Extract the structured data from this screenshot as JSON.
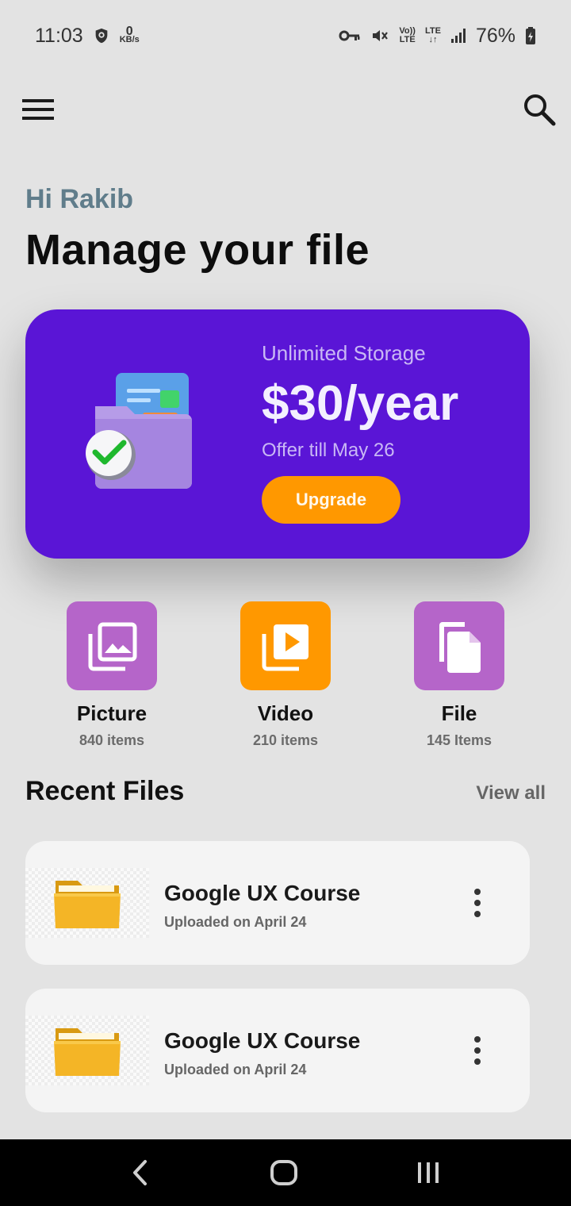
{
  "status_bar": {
    "time": "11:03",
    "net_speed_value": "0",
    "net_speed_unit": "KB/s",
    "volte_label_top": "Vo))",
    "volte_label_bottom": "LTE",
    "lte_label": "LTE",
    "battery": "76%"
  },
  "app_bar": {
    "menu_icon": "hamburger-menu-icon",
    "search_icon": "search-icon"
  },
  "greeting": "Hi Rakib",
  "title": "Manage your file",
  "promo": {
    "subtitle": "Unlimited Storage",
    "price": "$30/year",
    "offer": "Offer till May 26",
    "button_label": "Upgrade",
    "illustration": "folder-check-illustration"
  },
  "categories": [
    {
      "name": "Picture",
      "count": "840 items",
      "icon": "gallery-icon",
      "color": "#b565c9"
    },
    {
      "name": "Video",
      "count": "210 items",
      "icon": "video-library-icon",
      "color": "#ff9800"
    },
    {
      "name": "File",
      "count": "145 Items",
      "icon": "file-copy-icon",
      "color": "#b565c9"
    }
  ],
  "recent": {
    "title": "Recent Files",
    "view_all": "View all",
    "files": [
      {
        "name": "Google UX Course",
        "date": "Uploaded on April 24"
      },
      {
        "name": "Google UX Course",
        "date": "Uploaded on April 24"
      }
    ]
  },
  "colors": {
    "background": "#e3e3e3",
    "promo_card": "#5a15d6",
    "accent_orange": "#ff9800",
    "category_purple": "#b565c9",
    "greeting": "#607d8b"
  }
}
